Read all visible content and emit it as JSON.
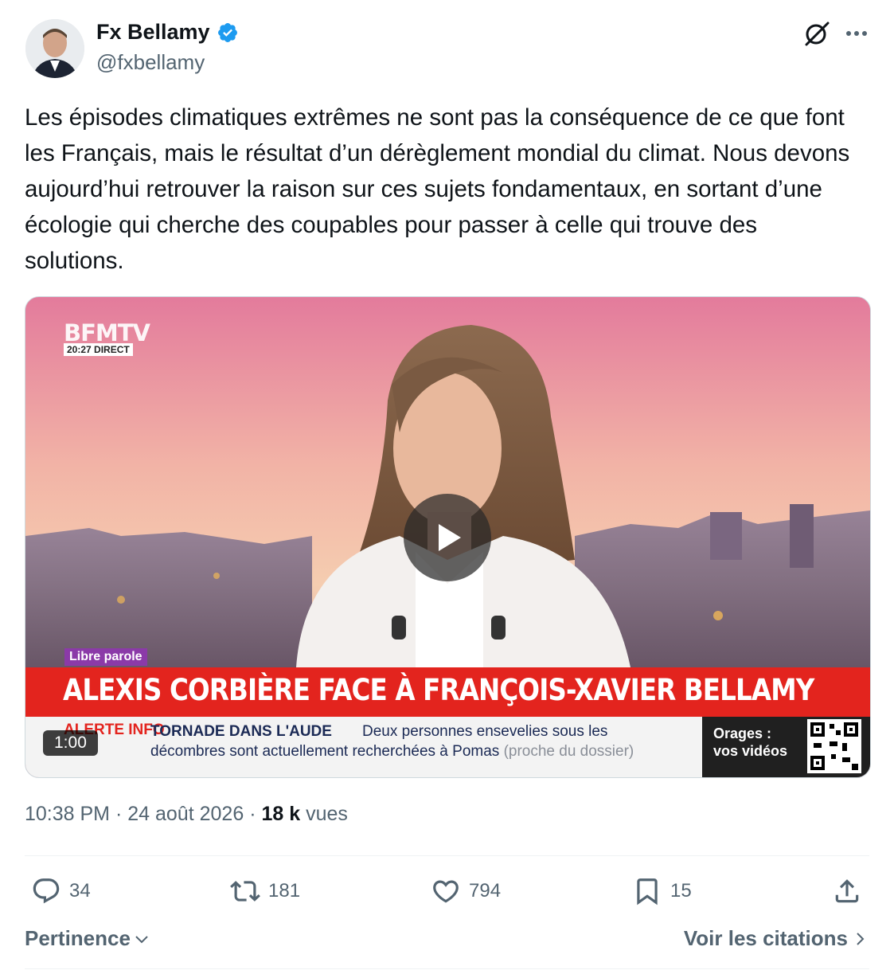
{
  "author": {
    "name": "Fx Bellamy",
    "handle": "@fxbellamy",
    "verified": true
  },
  "tweet": {
    "text": "Les épisodes climatiques extrêmes ne sont pas la conséquence de ce que font les Français, mais le résultat d’un dérèglement mondial du climat. Nous devons aujourd’hui retrouver la raison sur ces sujets fondamentaux, en sortant d’une écologie qui cherche des coupables pour passer à celle qui trouve des solutions.",
    "time": "10:38 PM",
    "date": "24 août 2026",
    "views_count": "18 k",
    "views_label": "vues",
    "separator": "·"
  },
  "video": {
    "duration": "1:00",
    "channel_logo": "BFMTV",
    "channel_time": "20:27",
    "channel_live": "DIRECT",
    "segment_tag": "Libre parole",
    "headline": "ALEXIS CORBIÈRE FACE À FRANÇOIS-XAVIER BELLAMY",
    "ticker_alert": "ALERTE INFO",
    "ticker_title": "TORNADE DANS L'AUDE",
    "ticker_line1": "Deux personnes ensevelies sous les",
    "ticker_line2": "décombres sont actuellement recherchées à Pomas",
    "ticker_note": "(proche du dossier)",
    "promo_line1": "Orages :",
    "promo_line2": "vos vidéos"
  },
  "actions": {
    "replies": "34",
    "retweets": "181",
    "likes": "794",
    "bookmarks": "15"
  },
  "footer": {
    "sort_label": "Pertinence",
    "quotes_label": "Voir les citations"
  },
  "icons": [
    "verified-badge-icon",
    "grok-icon",
    "more-icon",
    "play-icon",
    "reply-icon",
    "retweet-icon",
    "like-icon",
    "bookmark-icon",
    "share-icon",
    "chevron-down-icon",
    "chevron-right-icon"
  ],
  "colors": {
    "text_primary": "#0f1419",
    "text_secondary": "#536471",
    "verified_blue": "#1d9bf0",
    "bfm_red": "#e3241e"
  }
}
